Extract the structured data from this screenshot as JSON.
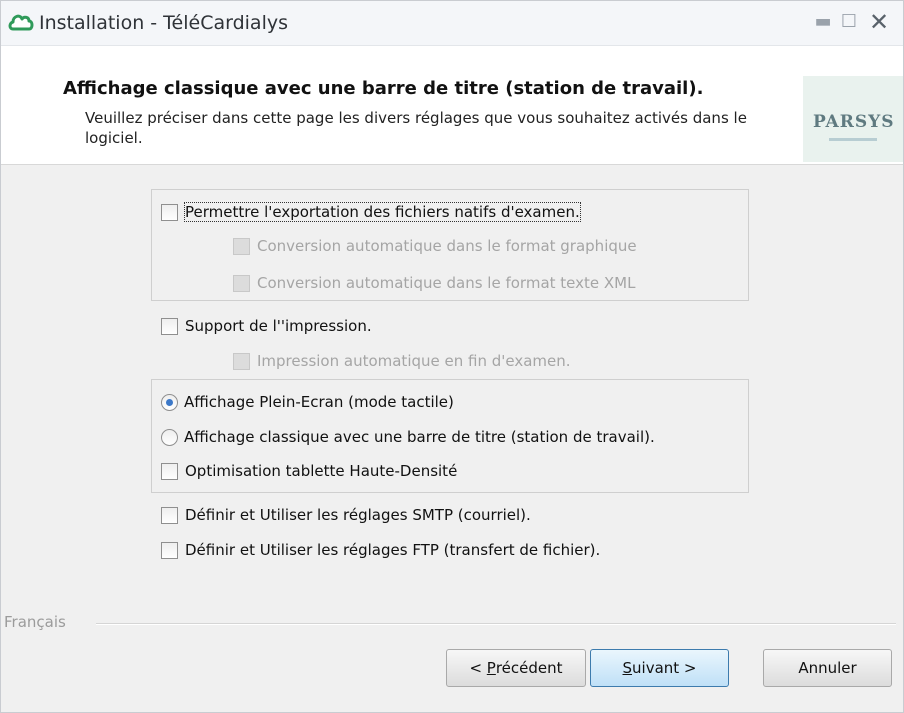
{
  "window": {
    "title": "Installation - TéléCardialys",
    "app_icon": "cloud-logo-icon",
    "controls": {
      "minimize": "minimize-icon",
      "maximize": "maximize-icon",
      "close": "close-icon"
    },
    "minimize_glyph": "▬",
    "maximize_glyph": "☐",
    "close_glyph": "✕"
  },
  "header": {
    "title": "Affichage classique avec une barre de titre (station de travail).",
    "description": "Veuillez préciser dans cette page les divers réglages que vous souhaitez activés dans le logiciel.",
    "logo_text": "PARSYS"
  },
  "options": {
    "export_native": {
      "label": "Permettre l'exportation des fichiers natifs d'examen.",
      "checked": false,
      "enabled": true
    },
    "convert_graphic": {
      "label": "Conversion automatique dans le format graphique",
      "checked": false,
      "enabled": false
    },
    "convert_xml": {
      "label": "Conversion automatique dans le format texte XML",
      "checked": false,
      "enabled": false
    },
    "print_support": {
      "label": "Support de l''impression.",
      "checked": false,
      "enabled": true
    },
    "auto_print": {
      "label": "Impression automatique en fin d'examen.",
      "checked": false,
      "enabled": false
    },
    "fullscreen": {
      "label": "Affichage Plein-Ecran (mode tactile)",
      "selected": true
    },
    "classic": {
      "label": "Affichage classique avec une barre de titre (station de travail).",
      "selected": false
    },
    "hd_tablet": {
      "label": "Optimisation tablette Haute-Densité",
      "checked": false
    },
    "smtp": {
      "label": "Définir et Utiliser les réglages SMTP (courriel).",
      "checked": false
    },
    "ftp": {
      "label": "Définir et Utiliser les réglages FTP (transfert de fichier).",
      "checked": false
    }
  },
  "footer": {
    "language": "Français",
    "buttons": {
      "prev_prefix": "< ",
      "prev_accel": "P",
      "prev_rest": "récédent",
      "next_accel": "S",
      "next_rest": "uivant >",
      "cancel": "Annuler"
    }
  },
  "colors": {
    "accent_blue": "#3c78c8",
    "app_icon": "#2f9a5a"
  }
}
